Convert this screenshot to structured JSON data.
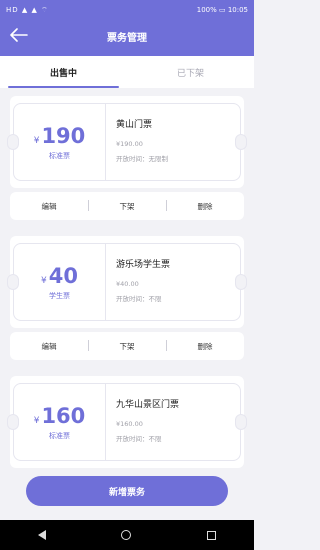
{
  "status": {
    "left": "HD ▲ ▲ ⌔",
    "right": "100% ▭ 10:05"
  },
  "header": {
    "title": "票务管理"
  },
  "tabs": [
    {
      "label": "出售中"
    },
    {
      "label": "已下架"
    }
  ],
  "tickets": [
    {
      "price": "190",
      "price_type": "标准票",
      "name": "黄山门票",
      "small_price": "¥190.00",
      "open_time": "开放时间：无限制"
    },
    {
      "price": "40",
      "price_type": "学生票",
      "name": "游乐场学生票",
      "small_price": "¥40.00",
      "open_time": "开放时间：不限"
    },
    {
      "price": "160",
      "price_type": "标准票",
      "name": "九华山景区门票",
      "small_price": "¥160.00",
      "open_time": "开放时间：不限"
    }
  ],
  "currency": "¥",
  "actions": {
    "edit": "编辑",
    "offline": "下架",
    "delete": "删除"
  },
  "add_button": "新增票务",
  "colors": {
    "accent": "#6f6fd8"
  }
}
